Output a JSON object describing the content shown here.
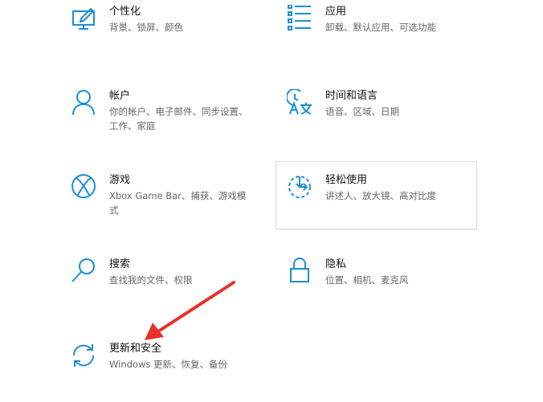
{
  "colors": {
    "accent": "#1a8fd6",
    "title_text": "#111111",
    "desc_text": "#666666",
    "annotation_arrow": "#e8302b"
  },
  "tiles": [
    {
      "title": "个性化",
      "desc": "背景、锁屏、颜色",
      "icon": "personalization-icon"
    },
    {
      "title": "应用",
      "desc": "卸载、默认应用、可选功能",
      "icon": "apps-icon"
    },
    {
      "title": "帐户",
      "desc": "你的帐户、电子邮件、同步设置、工作、家庭",
      "icon": "account-icon"
    },
    {
      "title": "时间和语言",
      "desc": "语音、区域、日期",
      "icon": "time-language-icon"
    },
    {
      "title": "游戏",
      "desc": "Xbox Game Bar、捕获、游戏模式",
      "icon": "xbox-icon"
    },
    {
      "title": "轻松使用",
      "desc": "讲述人、放大镜、高对比度",
      "icon": "ease-of-access-icon"
    },
    {
      "title": "搜索",
      "desc": "查找我的文件、权限",
      "icon": "search-icon"
    },
    {
      "title": "隐私",
      "desc": "位置、相机、麦克风",
      "icon": "lock-icon"
    },
    {
      "title": "更新和安全",
      "desc": "Windows 更新、恢复、备份",
      "icon": "update-sync-icon"
    }
  ]
}
